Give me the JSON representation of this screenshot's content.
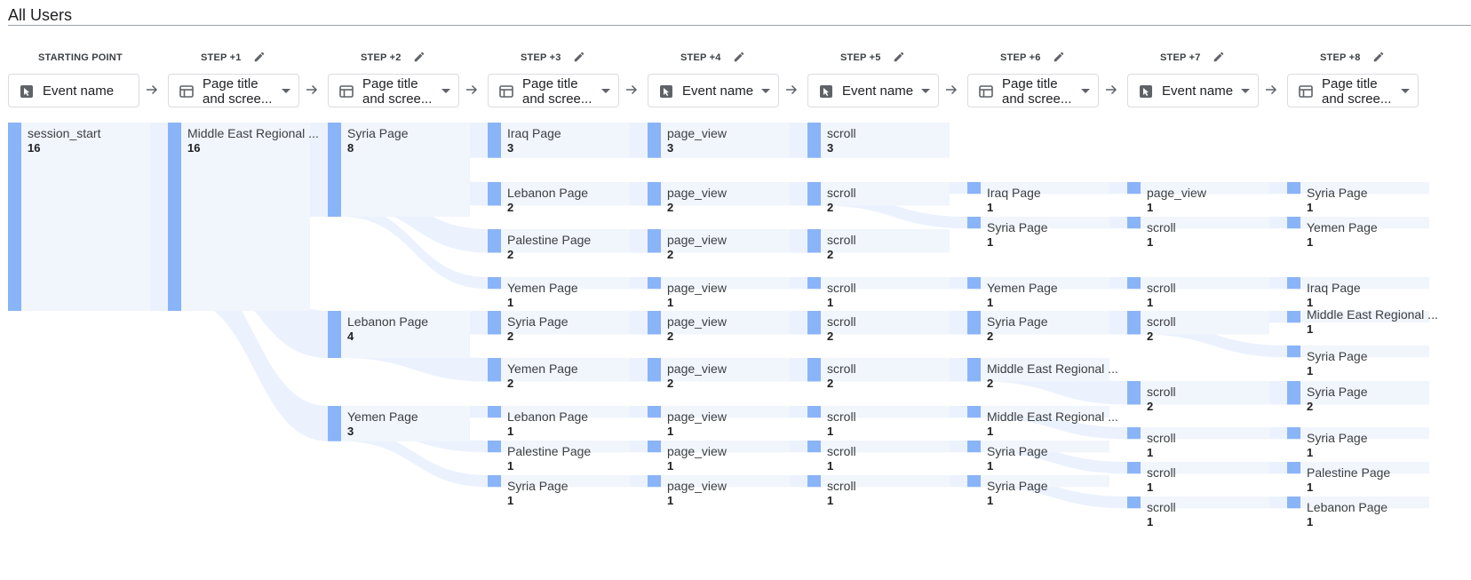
{
  "segment": {
    "title": "All Users"
  },
  "steps": [
    {
      "label": "STARTING POINT",
      "dimension": "Event name",
      "dim_type": "event",
      "editable": false
    },
    {
      "label": "STEP +1",
      "dimension": "Page title and scree...",
      "dim_type": "page",
      "editable": true
    },
    {
      "label": "STEP +2",
      "dimension": "Page title and scree...",
      "dim_type": "page",
      "editable": true
    },
    {
      "label": "STEP +3",
      "dimension": "Page title and scree...",
      "dim_type": "page",
      "editable": true
    },
    {
      "label": "STEP +4",
      "dimension": "Event name",
      "dim_type": "event",
      "editable": true
    },
    {
      "label": "STEP +5",
      "dimension": "Event name",
      "dim_type": "event",
      "editable": true
    },
    {
      "label": "STEP +6",
      "dimension": "Page title and scree...",
      "dim_type": "page",
      "editable": true
    },
    {
      "label": "STEP +7",
      "dimension": "Event name",
      "dim_type": "event",
      "editable": true
    },
    {
      "label": "STEP +8",
      "dimension": "Page title and scree...",
      "dim_type": "page",
      "editable": true
    }
  ],
  "colors": {
    "node": "#8ab4f8",
    "link": "#e8f0fe",
    "text": "#3c4043"
  },
  "nodes": [
    {
      "id": "s0",
      "step": 0,
      "name": "session_start",
      "value": 16
    },
    {
      "id": "a0",
      "step": 1,
      "name": "Middle East Regional ...",
      "value": 16
    },
    {
      "id": "b0",
      "step": 2,
      "name": "Syria Page",
      "value": 8
    },
    {
      "id": "b1",
      "step": 2,
      "name": "Lebanon Page",
      "value": 4
    },
    {
      "id": "b2",
      "step": 2,
      "name": "Yemen Page",
      "value": 3
    },
    {
      "id": "c0",
      "step": 3,
      "name": "Iraq Page",
      "value": 3
    },
    {
      "id": "c1",
      "step": 3,
      "name": "Lebanon Page",
      "value": 2
    },
    {
      "id": "c2",
      "step": 3,
      "name": "Palestine Page",
      "value": 2
    },
    {
      "id": "c3",
      "step": 3,
      "name": "Yemen Page",
      "value": 1
    },
    {
      "id": "c4",
      "step": 3,
      "name": "Syria Page",
      "value": 2
    },
    {
      "id": "c5",
      "step": 3,
      "name": "Yemen Page",
      "value": 2
    },
    {
      "id": "c6",
      "step": 3,
      "name": "Lebanon Page",
      "value": 1
    },
    {
      "id": "c7",
      "step": 3,
      "name": "Palestine Page",
      "value": 1
    },
    {
      "id": "c8",
      "step": 3,
      "name": "Syria Page",
      "value": 1
    },
    {
      "id": "d0",
      "step": 4,
      "name": "page_view",
      "value": 3
    },
    {
      "id": "d1",
      "step": 4,
      "name": "page_view",
      "value": 2
    },
    {
      "id": "d2",
      "step": 4,
      "name": "page_view",
      "value": 2
    },
    {
      "id": "d3",
      "step": 4,
      "name": "page_view",
      "value": 1
    },
    {
      "id": "d4",
      "step": 4,
      "name": "page_view",
      "value": 2
    },
    {
      "id": "d5",
      "step": 4,
      "name": "page_view",
      "value": 2
    },
    {
      "id": "d6",
      "step": 4,
      "name": "page_view",
      "value": 1
    },
    {
      "id": "d7",
      "step": 4,
      "name": "page_view",
      "value": 1
    },
    {
      "id": "d8",
      "step": 4,
      "name": "page_view",
      "value": 1
    },
    {
      "id": "e0",
      "step": 5,
      "name": "scroll",
      "value": 3
    },
    {
      "id": "e1",
      "step": 5,
      "name": "scroll",
      "value": 2
    },
    {
      "id": "e2",
      "step": 5,
      "name": "scroll",
      "value": 2
    },
    {
      "id": "e3",
      "step": 5,
      "name": "scroll",
      "value": 1
    },
    {
      "id": "e4",
      "step": 5,
      "name": "scroll",
      "value": 2
    },
    {
      "id": "e5",
      "step": 5,
      "name": "scroll",
      "value": 2
    },
    {
      "id": "e6",
      "step": 5,
      "name": "scroll",
      "value": 1
    },
    {
      "id": "e7",
      "step": 5,
      "name": "scroll",
      "value": 1
    },
    {
      "id": "e8",
      "step": 5,
      "name": "scroll",
      "value": 1
    },
    {
      "id": "f0",
      "step": 6,
      "name": "Iraq Page",
      "value": 1
    },
    {
      "id": "f1",
      "step": 6,
      "name": "Syria Page",
      "value": 1
    },
    {
      "id": "f2",
      "step": 6,
      "name": "Yemen Page",
      "value": 1
    },
    {
      "id": "f3",
      "step": 6,
      "name": "Syria Page",
      "value": 2
    },
    {
      "id": "f4",
      "step": 6,
      "name": "Middle East Regional ...",
      "value": 2
    },
    {
      "id": "f5",
      "step": 6,
      "name": "Middle East Regional ...",
      "value": 1
    },
    {
      "id": "f6",
      "step": 6,
      "name": "Syria Page",
      "value": 1
    },
    {
      "id": "f7",
      "step": 6,
      "name": "Syria Page",
      "value": 1
    },
    {
      "id": "g0",
      "step": 7,
      "name": "page_view",
      "value": 1
    },
    {
      "id": "g1",
      "step": 7,
      "name": "scroll",
      "value": 1
    },
    {
      "id": "g2",
      "step": 7,
      "name": "scroll",
      "value": 1
    },
    {
      "id": "g3",
      "step": 7,
      "name": "scroll",
      "value": 2
    },
    {
      "id": "g4",
      "step": 7,
      "name": "scroll",
      "value": 2
    },
    {
      "id": "g5",
      "step": 7,
      "name": "scroll",
      "value": 1
    },
    {
      "id": "g6",
      "step": 7,
      "name": "scroll",
      "value": 1
    },
    {
      "id": "g7",
      "step": 7,
      "name": "scroll",
      "value": 1
    },
    {
      "id": "h0",
      "step": 8,
      "name": "Syria Page",
      "value": 1
    },
    {
      "id": "h1",
      "step": 8,
      "name": "Yemen Page",
      "value": 1
    },
    {
      "id": "h2",
      "step": 8,
      "name": "Iraq Page",
      "value": 1
    },
    {
      "id": "h3",
      "step": 8,
      "name": "Middle East Regional ...",
      "value": 1
    },
    {
      "id": "h4",
      "step": 8,
      "name": "Syria Page",
      "value": 1
    },
    {
      "id": "h5",
      "step": 8,
      "name": "Syria Page",
      "value": 2
    },
    {
      "id": "h6",
      "step": 8,
      "name": "Syria Page",
      "value": 1
    },
    {
      "id": "h7",
      "step": 8,
      "name": "Palestine Page",
      "value": 1
    },
    {
      "id": "h8",
      "step": 8,
      "name": "Lebanon Page",
      "value": 1
    }
  ],
  "links": [
    {
      "from": "s0",
      "to": "a0",
      "value": 16
    },
    {
      "from": "a0",
      "to": "b0",
      "value": 8
    },
    {
      "from": "a0",
      "to": "b1",
      "value": 4
    },
    {
      "from": "a0",
      "to": "b2",
      "value": 3
    },
    {
      "from": "b0",
      "to": "c0",
      "value": 3
    },
    {
      "from": "b0",
      "to": "c1",
      "value": 2
    },
    {
      "from": "b0",
      "to": "c2",
      "value": 2
    },
    {
      "from": "b0",
      "to": "c3",
      "value": 1
    },
    {
      "from": "b1",
      "to": "c4",
      "value": 2
    },
    {
      "from": "b1",
      "to": "c5",
      "value": 2
    },
    {
      "from": "b2",
      "to": "c6",
      "value": 1
    },
    {
      "from": "b2",
      "to": "c7",
      "value": 1
    },
    {
      "from": "b2",
      "to": "c8",
      "value": 1
    },
    {
      "from": "c0",
      "to": "d0",
      "value": 3
    },
    {
      "from": "c1",
      "to": "d1",
      "value": 2
    },
    {
      "from": "c2",
      "to": "d2",
      "value": 2
    },
    {
      "from": "c3",
      "to": "d3",
      "value": 1
    },
    {
      "from": "c4",
      "to": "d4",
      "value": 2
    },
    {
      "from": "c5",
      "to": "d5",
      "value": 2
    },
    {
      "from": "c6",
      "to": "d6",
      "value": 1
    },
    {
      "from": "c7",
      "to": "d7",
      "value": 1
    },
    {
      "from": "c8",
      "to": "d8",
      "value": 1
    },
    {
      "from": "d0",
      "to": "e0",
      "value": 3
    },
    {
      "from": "d1",
      "to": "e1",
      "value": 2
    },
    {
      "from": "d2",
      "to": "e2",
      "value": 2
    },
    {
      "from": "d3",
      "to": "e3",
      "value": 1
    },
    {
      "from": "d4",
      "to": "e4",
      "value": 2
    },
    {
      "from": "d5",
      "to": "e5",
      "value": 2
    },
    {
      "from": "d6",
      "to": "e6",
      "value": 1
    },
    {
      "from": "d7",
      "to": "e7",
      "value": 1
    },
    {
      "from": "d8",
      "to": "e8",
      "value": 1
    },
    {
      "from": "e1",
      "to": "f0",
      "value": 1
    },
    {
      "from": "e1",
      "to": "f1",
      "value": 1
    },
    {
      "from": "e3",
      "to": "f2",
      "value": 1
    },
    {
      "from": "e4",
      "to": "f3",
      "value": 2
    },
    {
      "from": "e5",
      "to": "f4",
      "value": 2
    },
    {
      "from": "e6",
      "to": "f5",
      "value": 1
    },
    {
      "from": "e7",
      "to": "f6",
      "value": 1
    },
    {
      "from": "e8",
      "to": "f7",
      "value": 1
    },
    {
      "from": "f0",
      "to": "g0",
      "value": 1
    },
    {
      "from": "f1",
      "to": "g1",
      "value": 1
    },
    {
      "from": "f2",
      "to": "g2",
      "value": 1
    },
    {
      "from": "f3",
      "to": "g3",
      "value": 2
    },
    {
      "from": "f4",
      "to": "g4",
      "value": 2
    },
    {
      "from": "f5",
      "to": "g5",
      "value": 1
    },
    {
      "from": "f6",
      "to": "g6",
      "value": 1
    },
    {
      "from": "f7",
      "to": "g7",
      "value": 1
    },
    {
      "from": "g0",
      "to": "h0",
      "value": 1
    },
    {
      "from": "g1",
      "to": "h1",
      "value": 1
    },
    {
      "from": "g2",
      "to": "h2",
      "value": 1
    },
    {
      "from": "g3",
      "to": "h3",
      "value": 1
    },
    {
      "from": "g3",
      "to": "h4",
      "value": 1
    },
    {
      "from": "g4",
      "to": "h5",
      "value": 2
    },
    {
      "from": "g5",
      "to": "h6",
      "value": 1
    },
    {
      "from": "g6",
      "to": "h7",
      "value": 1
    },
    {
      "from": "g7",
      "to": "h8",
      "value": 1
    }
  ]
}
